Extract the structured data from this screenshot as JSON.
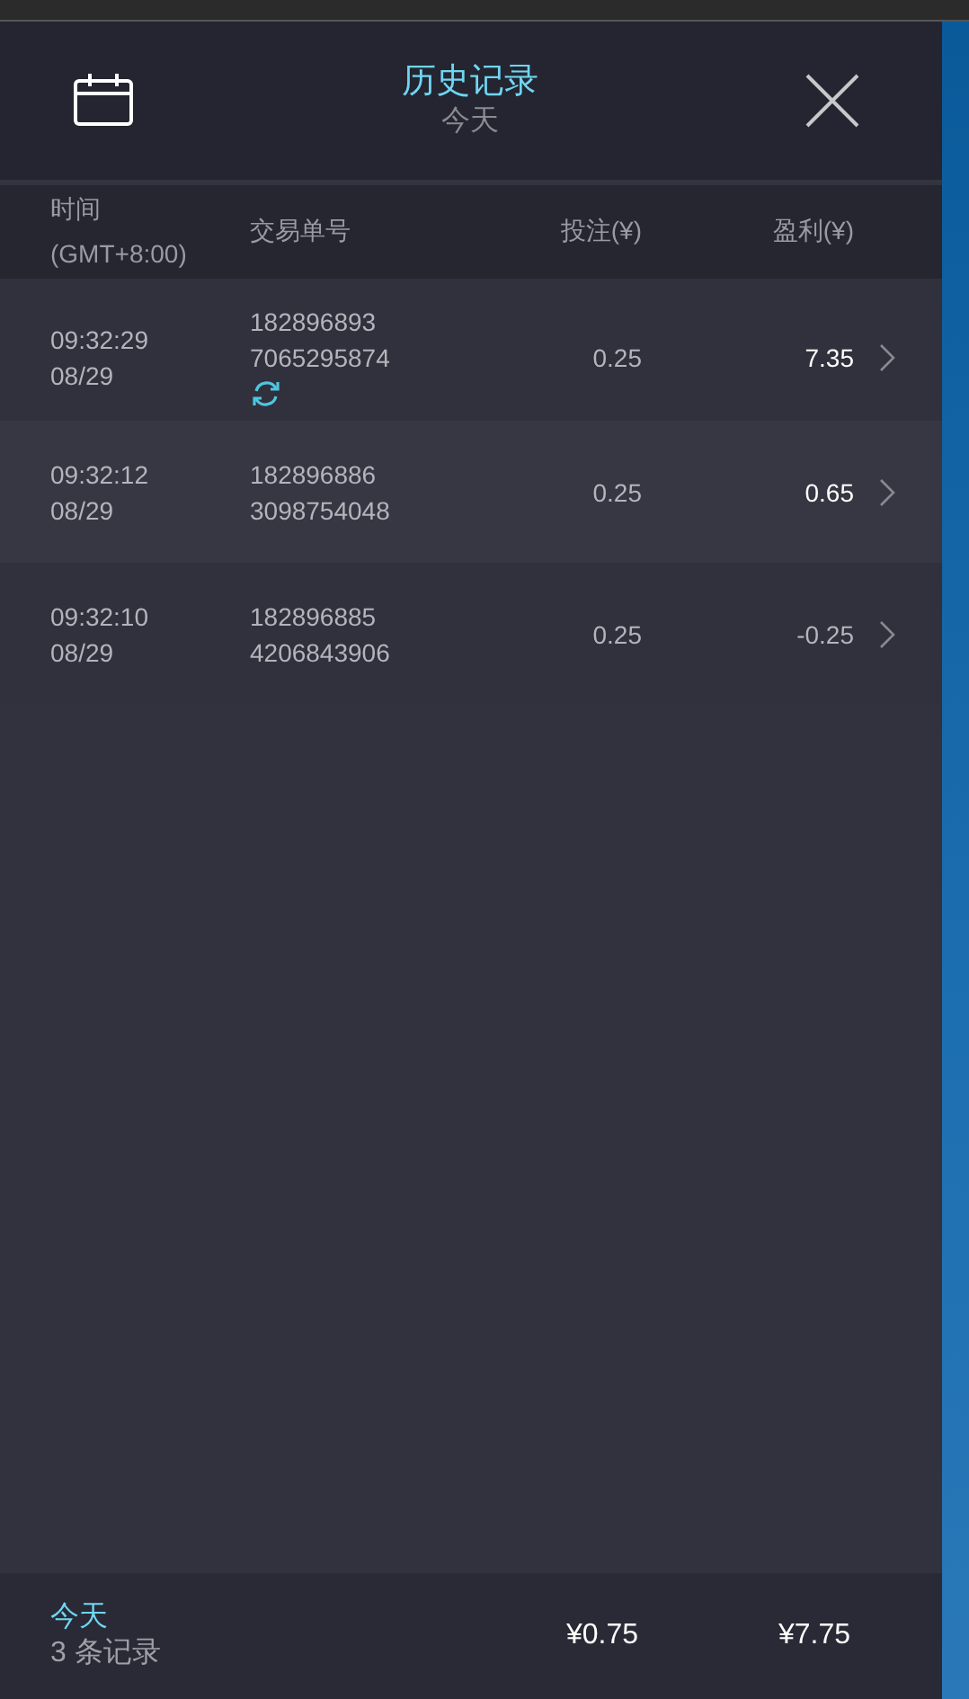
{
  "header": {
    "title": "历史记录",
    "subtitle": "今天"
  },
  "columns": [
    {
      "label": "时间",
      "sublabel": "(GMT+8:00)"
    },
    {
      "label": "交易单号"
    },
    {
      "label": "投注(¥)"
    },
    {
      "label": "盈利(¥)"
    }
  ],
  "rows": [
    {
      "time": "09:32:29",
      "date": "08/29",
      "order": [
        "182896893",
        "7065295874"
      ],
      "pending": true,
      "stake": "0.25",
      "profit": "7.35",
      "win": true
    },
    {
      "time": "09:32:12",
      "date": "08/29",
      "order": [
        "182896886",
        "3098754048"
      ],
      "pending": false,
      "stake": "0.25",
      "profit": "0.65",
      "win": true
    },
    {
      "time": "09:32:10",
      "date": "08/29",
      "order": [
        "182896885",
        "4206843906"
      ],
      "pending": false,
      "stake": "0.25",
      "profit": "-0.25",
      "win": false
    }
  ],
  "footer": {
    "period": "今天",
    "count": "3 条记录",
    "stake_total": "¥0.75",
    "profit_total": "¥7.75"
  }
}
